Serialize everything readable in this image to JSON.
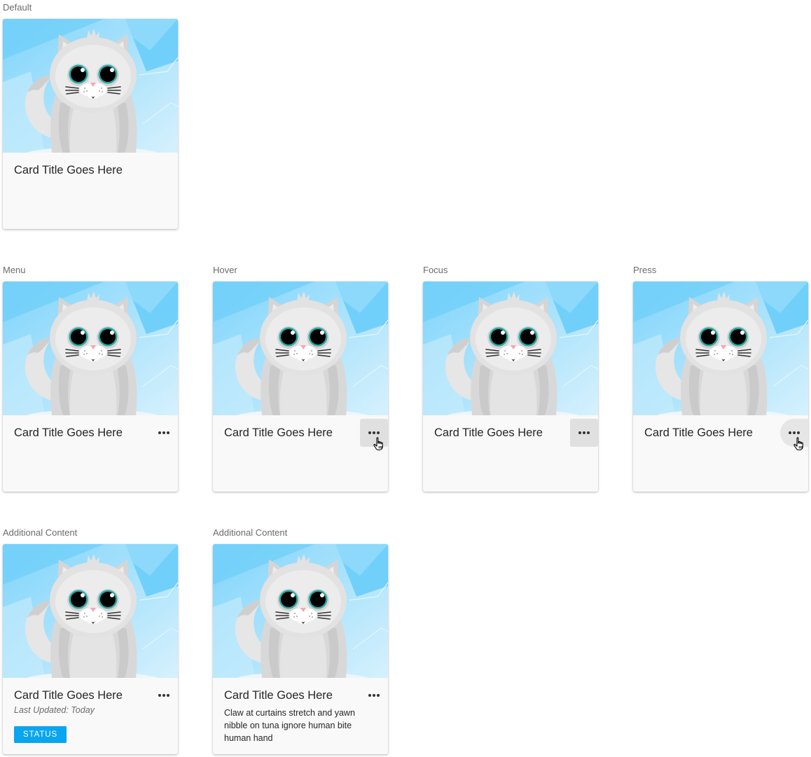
{
  "colors": {
    "sky_light": "#cdeefc",
    "sky_dark": "#6fcff9",
    "cat_fur": "#d9d9d9",
    "eye_iris": "#28a8a3",
    "status_badge": "#0aa5f0",
    "card_bg": "#f9f9f9"
  },
  "card_image": "cat-illustration",
  "sections": {
    "default": "Default",
    "menu": "Menu",
    "hover": "Hover",
    "focus": "Focus",
    "press": "Press",
    "additional_1": "Additional Content",
    "additional_2": "Additional Content"
  },
  "cards": {
    "default": {
      "title": "Card Title Goes Here"
    },
    "menu": {
      "title": "Card Title Goes Here",
      "menu_icon": "more-horizontal-icon"
    },
    "hover": {
      "title": "Card Title Goes Here",
      "menu_icon": "more-horizontal-icon",
      "cursor_icon": "hand-pointer-icon"
    },
    "focus": {
      "title": "Card Title Goes Here",
      "menu_icon": "more-horizontal-icon"
    },
    "press": {
      "title": "Card Title Goes Here",
      "menu_icon": "more-horizontal-icon",
      "cursor_icon": "hand-pointer-icon"
    },
    "additional_1": {
      "title": "Card Title Goes Here",
      "subtitle": "Last Updated: Today",
      "status": "STATUS",
      "menu_icon": "more-horizontal-icon"
    },
    "additional_2": {
      "title": "Card Title Goes Here",
      "body": "Claw at curtains stretch and yawn nibble on tuna ignore human bite human hand",
      "menu_icon": "more-horizontal-icon"
    }
  }
}
